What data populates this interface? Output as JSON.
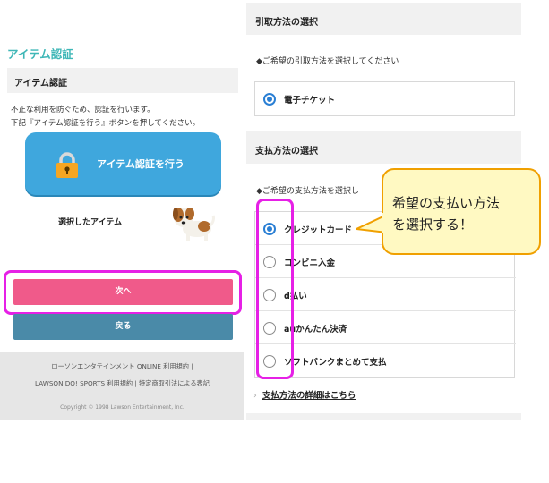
{
  "left": {
    "section_title": "アイテム認証",
    "subheader": "アイテム認証",
    "description": [
      "不正な利用を防ぐため、認証を行います。",
      "下記『アイテム認証を行う』ボタンを押してください。"
    ],
    "auth_button_label": "アイテム認証を行う",
    "selected_item_label": "選択したアイテム",
    "next_button_label": "次へ",
    "back_button_label": "戻る",
    "footer": {
      "line1": "ローソンエンタテインメント ONLINE 利用規約 |",
      "line2": "LAWSON DO! SPORTS 利用規約 |  特定商取引法による表記",
      "copyright": "Copyright © 1998 Lawson Entertainment, Inc."
    }
  },
  "right": {
    "pickup_heading": "引取方法の選択",
    "pickup_prompt": "◆ご希望の引取方法を選択してください",
    "pickup_options": [
      {
        "label": "電子チケット",
        "selected": true
      }
    ],
    "payment_heading": "支払方法の選択",
    "payment_prompt": "◆ご希望の支払方法を選択し",
    "payment_options": [
      {
        "label": "クレジットカード",
        "selected": true
      },
      {
        "label": "コンビニ入金",
        "selected": false
      },
      {
        "label": "d払い",
        "selected": false
      },
      {
        "label": "auかんたん決済",
        "selected": false
      },
      {
        "label": "ソフトバンクまとめて支払",
        "selected": false
      }
    ],
    "payment_detail_link": "支払方法の詳細はこちら"
  },
  "callout": {
    "line1": "希望の支払い方法",
    "line2": "を選択する！"
  },
  "colors": {
    "accent_teal": "#3fb7b7",
    "auth_button": "#3fa7dd",
    "next_button": "#f05a8a",
    "back_button": "#4a8aa8",
    "highlight": "#e620e6",
    "callout_bg": "#fff9c2",
    "callout_border": "#f0a000",
    "radio_selected": "#2a7fd4"
  },
  "icons": {
    "auth_button_icon": "lock-icon",
    "selected_item_image": "dog-illustration"
  }
}
